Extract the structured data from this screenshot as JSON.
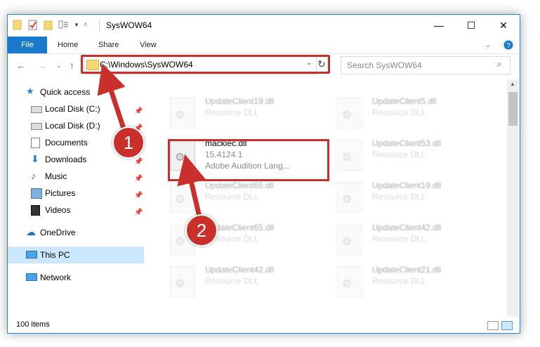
{
  "window": {
    "title": "SysWOW64",
    "minimize": "—",
    "maximize": "☐",
    "close": "✕"
  },
  "ribbon": {
    "file": "File",
    "home": "Home",
    "share": "Share",
    "view": "View"
  },
  "address": {
    "path": "C:\\Windows\\SysWOW64",
    "search_placeholder": "Search SysWOW64"
  },
  "nav": {
    "quick_access": "Quick access",
    "items": [
      {
        "label": "Local Disk (C:)",
        "icon": "drive-icon",
        "pinned": true
      },
      {
        "label": "Local Disk (D:)",
        "icon": "drive-icon",
        "pinned": true
      },
      {
        "label": "Documents",
        "icon": "documents-icon",
        "pinned": true
      },
      {
        "label": "Downloads",
        "icon": "downloads-icon",
        "pinned": true
      },
      {
        "label": "Music",
        "icon": "music-icon",
        "pinned": true
      },
      {
        "label": "Pictures",
        "icon": "pictures-icon",
        "pinned": true
      },
      {
        "label": "Videos",
        "icon": "videos-icon",
        "pinned": true
      }
    ],
    "onedrive": "OneDrive",
    "this_pc": "This PC",
    "network": "Network"
  },
  "files": [
    {
      "name": "UpdateClient19.dll",
      "line2": "Resource DLL",
      "line3": ""
    },
    {
      "name": "UpdateClient5.dll",
      "line2": "Resource DLL",
      "line3": ""
    },
    {
      "name": "mackiec.dll",
      "line2": "15.4124.1",
      "line3": "Adobe Audition Lang..."
    },
    {
      "name": "UpdateClient53.dll",
      "line2": "Resource DLL",
      "line3": ""
    },
    {
      "name": "UpdateClient65.dll",
      "line2": "Resource DLL",
      "line3": ""
    },
    {
      "name": "UpdateClient19.dll",
      "line2": "Resource DLL",
      "line3": ""
    },
    {
      "name": "UpdateClient65.dll",
      "line2": "Resource DLL",
      "line3": ""
    },
    {
      "name": "UpdateClient42.dll",
      "line2": "Resource DLL",
      "line3": ""
    },
    {
      "name": "UpdateClient42.dll",
      "line2": "Resource DLL",
      "line3": ""
    },
    {
      "name": "UpdateClient21.dll",
      "line2": "Resource DLL",
      "line3": ""
    }
  ],
  "status": {
    "item_count": "100 items"
  },
  "annotations": {
    "step1": "1",
    "step2": "2",
    "color": "#c9302c"
  }
}
